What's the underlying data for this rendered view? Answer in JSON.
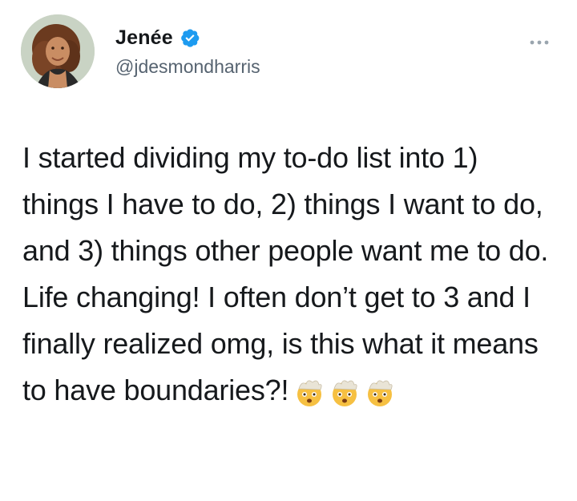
{
  "tweet": {
    "author": {
      "display_name": "Jenée",
      "handle": "@jdesmondharris",
      "verified": true,
      "verified_icon": "verified-badge-icon",
      "avatar_icon": "profile-avatar"
    },
    "more_icon": "more-options-icon",
    "text": "I started dividing my to-do list into 1) things I have to do, 2) things I want to do, and 3) things other people want me to do. Life changing! I often don’t get to 3 and I finally realized omg, is this what it means to have boundaries?!",
    "emojis": [
      "exploding-head-emoji",
      "exploding-head-emoji",
      "exploding-head-emoji"
    ]
  },
  "colors": {
    "text": "#14171a",
    "secondary_text": "#566370",
    "verified_blue": "#1d9bf0"
  }
}
